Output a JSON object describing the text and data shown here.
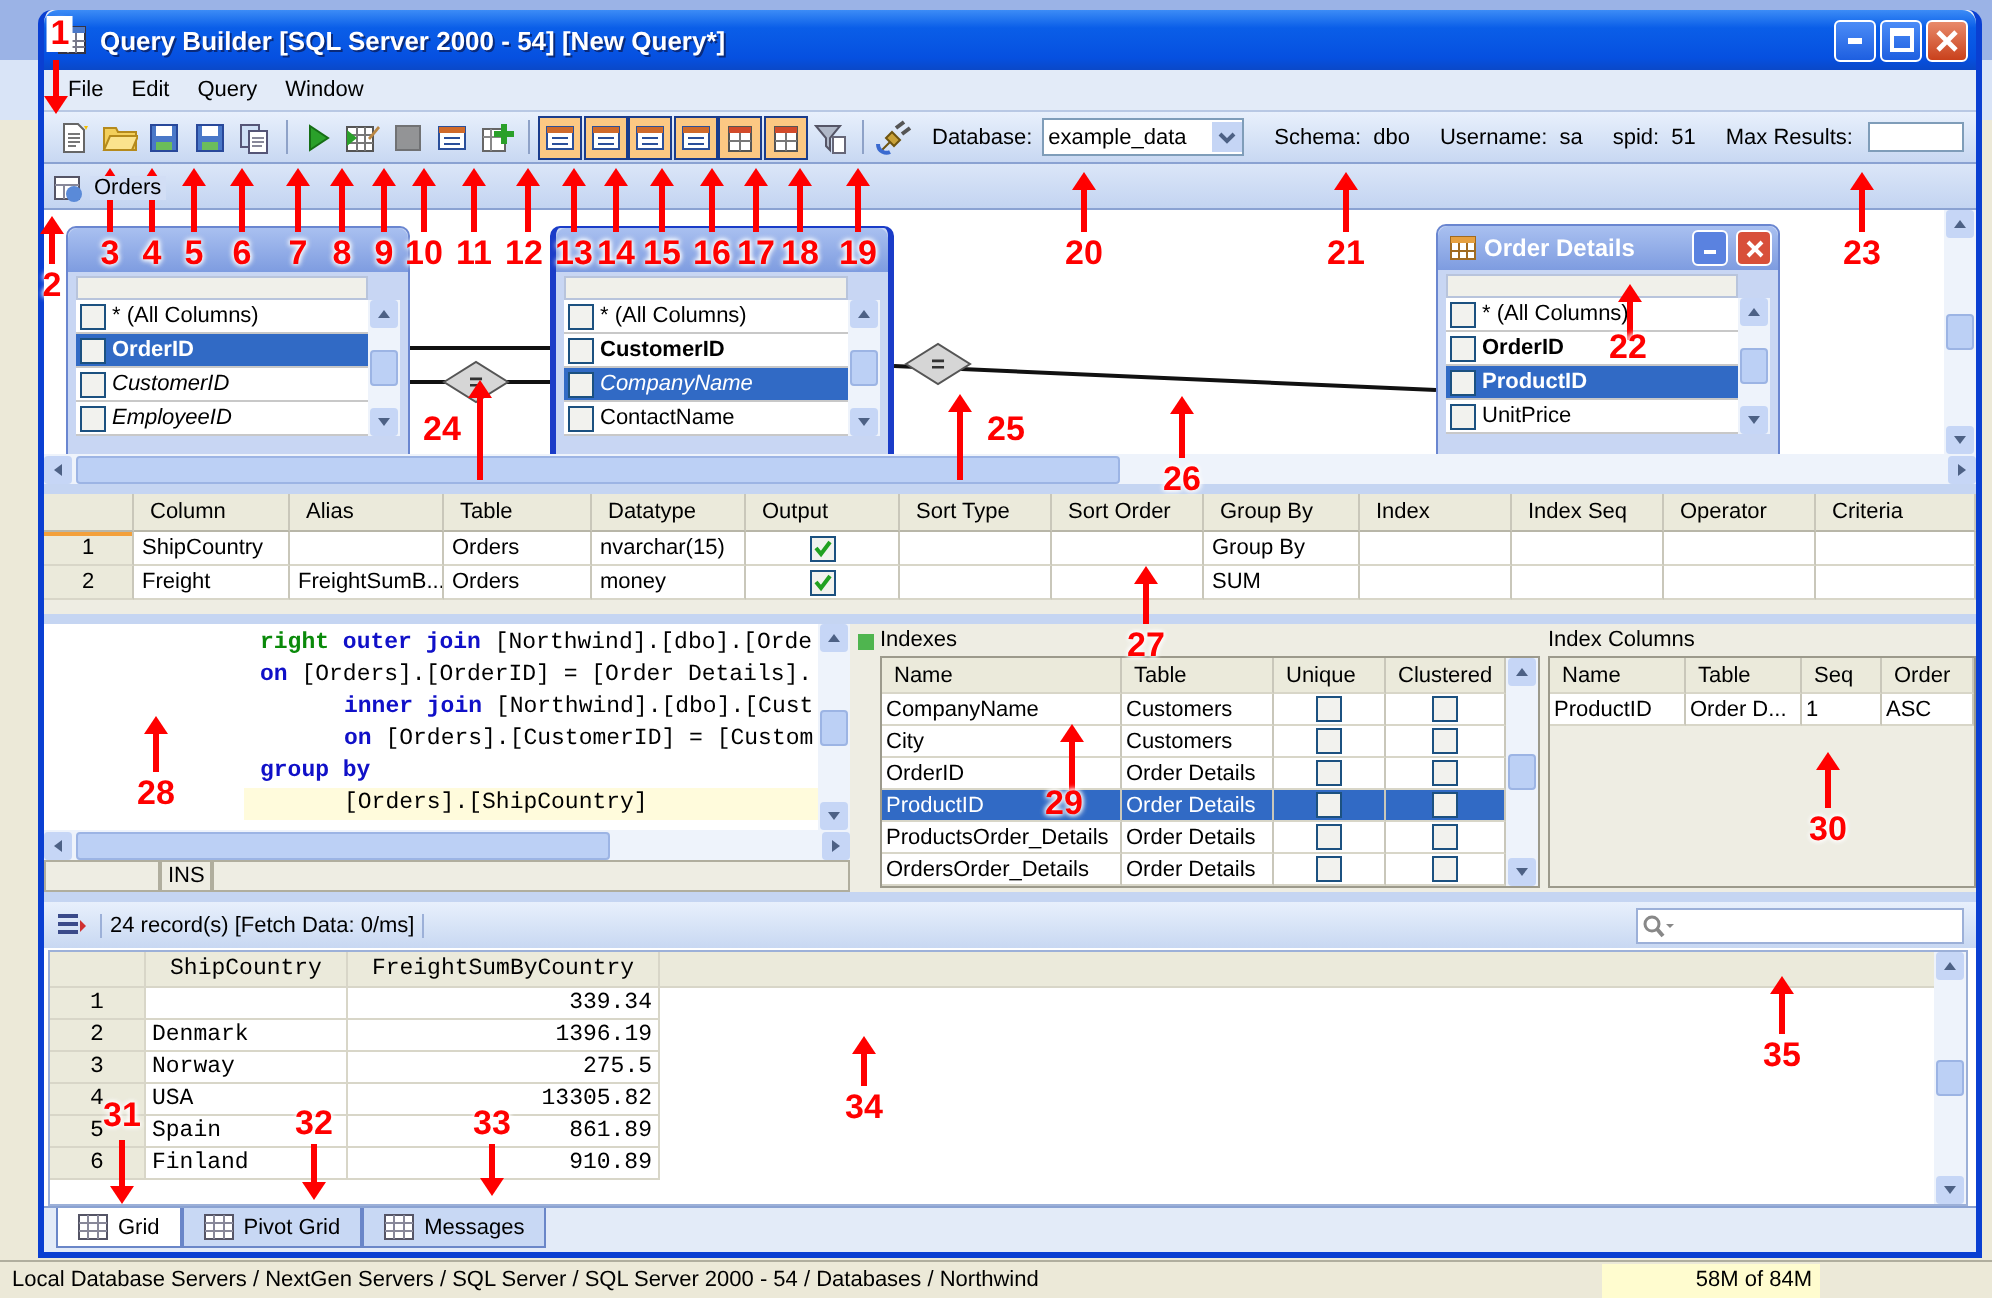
{
  "window": {
    "title": "Query Builder [SQL Server 2000 - 54] [New Query*]"
  },
  "menu": [
    "File",
    "Edit",
    "Query",
    "Window"
  ],
  "toolbar": {
    "groups": [
      [
        {
          "on": false,
          "disabled": false
        },
        {
          "on": false,
          "disabled": false
        },
        {
          "on": false,
          "disabled": false
        },
        {
          "on": false,
          "disabled": false
        },
        {
          "on": false,
          "disabled": false
        }
      ],
      [
        {
          "on": false,
          "disabled": false
        },
        {
          "on": false,
          "disabled": false
        },
        {
          "on": false,
          "disabled": true
        },
        {
          "on": false,
          "disabled": false
        },
        {
          "on": false,
          "disabled": false
        }
      ],
      [
        {
          "on": true,
          "disabled": false
        },
        {
          "on": true,
          "disabled": false
        },
        {
          "on": true,
          "disabled": false
        },
        {
          "on": true,
          "disabled": false
        },
        {
          "on": true,
          "disabled": false
        },
        {
          "on": true,
          "disabled": false
        },
        {
          "on": false,
          "disabled": false
        }
      ],
      [
        {
          "on": false,
          "disabled": false
        }
      ]
    ],
    "database": {
      "label": "Database:",
      "value": "example_data"
    },
    "info": [
      {
        "label": "Schema:",
        "value": "dbo"
      },
      {
        "label": "Username:",
        "value": "sa"
      },
      {
        "label": "spid:",
        "value": "51"
      }
    ],
    "max_results": {
      "label": "Max Results:"
    }
  },
  "document_tab": {
    "label": "Orders"
  },
  "diagram": {
    "tables": [
      {
        "columns": [
          {
            "name": "* (All Columns)",
            "kind": "plain",
            "selected": false
          },
          {
            "name": "OrderID",
            "kind": "key",
            "selected": true
          },
          {
            "name": "CustomerID",
            "kind": "foreign",
            "selected": false
          },
          {
            "name": "EmployeeID",
            "kind": "foreign",
            "selected": false
          }
        ]
      },
      {
        "columns": [
          {
            "name": "* (All Columns)",
            "kind": "plain",
            "selected": false
          },
          {
            "name": "CustomerID",
            "kind": "key",
            "selected": false
          },
          {
            "name": "CompanyName",
            "kind": "foreign",
            "selected": true
          },
          {
            "name": "ContactName",
            "kind": "plain",
            "selected": false
          }
        ]
      },
      {
        "title": "Order Details",
        "columns": [
          {
            "name": "* (All Columns)",
            "kind": "plain",
            "selected": false
          },
          {
            "name": "OrderID",
            "kind": "key",
            "selected": false
          },
          {
            "name": "ProductID",
            "kind": "key",
            "selected": true
          },
          {
            "name": "UnitPrice",
            "kind": "plain",
            "selected": false
          }
        ]
      }
    ],
    "joins": [
      {
        "label": "="
      },
      {
        "label": "="
      }
    ]
  },
  "query_grid": {
    "columns": [
      "Column",
      "Alias",
      "Table",
      "Datatype",
      "Output",
      "Sort Type",
      "Sort Order",
      "Group By",
      "Index",
      "Index Seq",
      "Operator",
      "Criteria"
    ],
    "rows": [
      {
        "number": "1",
        "column": "ShipCountry",
        "table": "Orders",
        "datatype": "nvarchar(15)",
        "output": true,
        "group_by": "Group By",
        "selected": true
      },
      {
        "number": "2",
        "column": "Freight",
        "alias": "FreightSumB...",
        "table": "Orders",
        "datatype": "money",
        "output": true,
        "group_by": "SUM",
        "selected": false
      }
    ]
  },
  "sql_editor": {
    "lines": [
      {
        "kind": "clause",
        "current": false,
        "segments": [
          {
            "kind": "modifier",
            "text": "right"
          },
          {
            "kind": "keyword",
            "text": " outer join"
          },
          {
            "kind": "plain",
            "text": " [Northwind].[dbo].[Orde"
          }
        ]
      },
      {
        "kind": "clause",
        "current": false,
        "segments": [
          {
            "kind": "keyword",
            "text": "on"
          },
          {
            "kind": "plain",
            "text": " [Orders].[OrderID] = [Order Details]."
          }
        ]
      },
      {
        "kind": "nested",
        "current": false,
        "segments": [
          {
            "kind": "keyword",
            "text": "inner join"
          },
          {
            "kind": "plain",
            "text": " [Northwind].[dbo].[Cust"
          }
        ]
      },
      {
        "kind": "nested",
        "current": false,
        "segments": [
          {
            "kind": "keyword",
            "text": "on"
          },
          {
            "kind": "plain",
            "text": " [Orders].[CustomerID] = [Custom"
          }
        ]
      },
      {
        "kind": "clause",
        "current": false,
        "segments": [
          {
            "kind": "keyword",
            "text": "group by"
          }
        ]
      },
      {
        "kind": "nested",
        "current": true,
        "segments": [
          {
            "kind": "plain",
            "text": "[Orders].[ShipCountry]"
          }
        ]
      }
    ],
    "mode": "INS"
  },
  "indexes": {
    "title": "Indexes",
    "columns": [
      "Name",
      "Table",
      "Unique",
      "Clustered"
    ],
    "rows": [
      {
        "name": "CompanyName",
        "table": "Customers",
        "unique": false,
        "clustered": false,
        "selected": false
      },
      {
        "name": "City",
        "table": "Customers",
        "unique": false,
        "clustered": false,
        "selected": false
      },
      {
        "name": "OrderID",
        "table": "Order Details",
        "unique": false,
        "clustered": false,
        "selected": false
      },
      {
        "name": "ProductID",
        "table": "Order Details",
        "unique": false,
        "clustered": false,
        "selected": true
      },
      {
        "name": "ProductsOrder_Details",
        "table": "Order Details",
        "unique": false,
        "clustered": false,
        "selected": false
      },
      {
        "name": "OrdersOrder_Details",
        "table": "Order Details",
        "unique": false,
        "clustered": false,
        "selected": false
      }
    ]
  },
  "index_columns": {
    "title": "Index Columns",
    "columns": [
      "Name",
      "Table",
      "Seq",
      "Order"
    ],
    "rows": [
      [
        "ProductID",
        "Order D...",
        "1",
        "ASC"
      ]
    ]
  },
  "results": {
    "summary": "24 record(s) [Fetch Data: 0/ms]",
    "columns": [
      "ShipCountry",
      "FreightSumByCountry"
    ],
    "rows": [
      {
        "number": "1",
        "cells": [
          "",
          "339.34"
        ]
      },
      {
        "number": "2",
        "cells": [
          "Denmark",
          "1396.19"
        ]
      },
      {
        "number": "3",
        "cells": [
          "Norway",
          "275.5"
        ]
      },
      {
        "number": "4",
        "cells": [
          "USA",
          "13305.82"
        ]
      },
      {
        "number": "5",
        "cells": [
          "Spain",
          "861.89"
        ]
      },
      {
        "number": "6",
        "cells": [
          "Finland",
          "910.89"
        ]
      }
    ],
    "tabs": [
      {
        "label": "Grid",
        "selected": true
      },
      {
        "label": "Pivot Grid",
        "selected": false
      },
      {
        "label": "Messages",
        "selected": false
      }
    ]
  },
  "status_bar": {
    "path": "Local Database Servers / NextGen Servers / SQL Server / SQL Server 2000 - 54 / Databases / Northwind",
    "memory": "58M of 84M"
  },
  "callouts": [
    "1",
    "2",
    "3",
    "4",
    "5",
    "6",
    "7",
    "8",
    "9",
    "10",
    "11",
    "12",
    "13",
    "14",
    "15",
    "16",
    "17",
    "18",
    "19",
    "20",
    "21",
    "22",
    "23",
    "24",
    "25",
    "26",
    "27",
    "28",
    "29",
    "30",
    "31",
    "32",
    "33",
    "34",
    "35"
  ]
}
